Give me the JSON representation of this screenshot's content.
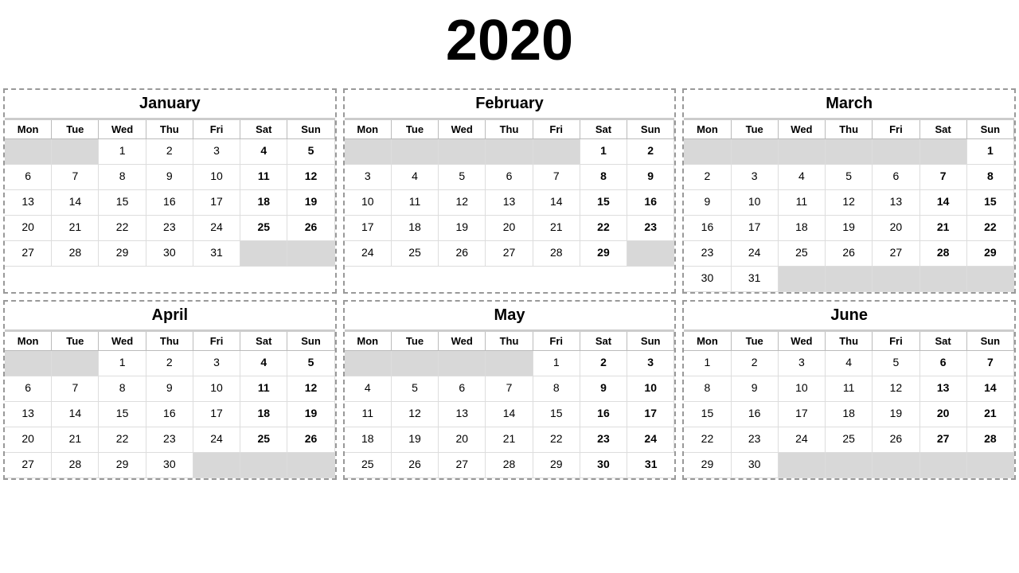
{
  "title": "2020",
  "months": [
    {
      "name": "January",
      "startDay": 2,
      "days": 31,
      "weeks": [
        [
          null,
          null,
          1,
          2,
          3,
          4,
          5
        ],
        [
          6,
          7,
          8,
          9,
          10,
          11,
          12
        ],
        [
          13,
          14,
          15,
          16,
          17,
          18,
          19
        ],
        [
          20,
          21,
          22,
          23,
          24,
          25,
          26
        ],
        [
          27,
          28,
          29,
          30,
          31,
          null,
          null
        ]
      ]
    },
    {
      "name": "February",
      "startDay": 6,
      "days": 29,
      "weeks": [
        [
          null,
          null,
          null,
          null,
          null,
          1,
          2
        ],
        [
          3,
          4,
          5,
          6,
          7,
          8,
          9
        ],
        [
          10,
          11,
          12,
          13,
          14,
          15,
          16
        ],
        [
          17,
          18,
          19,
          20,
          21,
          22,
          23
        ],
        [
          24,
          25,
          26,
          27,
          28,
          29,
          null
        ]
      ]
    },
    {
      "name": "March",
      "startDay": 0,
      "days": 31,
      "weeks": [
        [
          null,
          null,
          null,
          null,
          null,
          null,
          1
        ],
        [
          2,
          3,
          4,
          5,
          6,
          7,
          8
        ],
        [
          9,
          10,
          11,
          12,
          13,
          14,
          15
        ],
        [
          16,
          17,
          18,
          19,
          20,
          21,
          22
        ],
        [
          23,
          24,
          25,
          26,
          27,
          28,
          29
        ],
        [
          30,
          31,
          null,
          null,
          null,
          null,
          null
        ]
      ]
    },
    {
      "name": "April",
      "startDay": 2,
      "days": 30,
      "weeks": [
        [
          null,
          null,
          1,
          2,
          3,
          4,
          5
        ],
        [
          6,
          7,
          8,
          9,
          10,
          11,
          12
        ],
        [
          13,
          14,
          15,
          16,
          17,
          18,
          19
        ],
        [
          20,
          21,
          22,
          23,
          24,
          25,
          26
        ],
        [
          27,
          28,
          29,
          30,
          null,
          null,
          null
        ]
      ]
    },
    {
      "name": "May",
      "startDay": 4,
      "days": 31,
      "weeks": [
        [
          null,
          null,
          null,
          null,
          1,
          2,
          3
        ],
        [
          4,
          5,
          6,
          7,
          8,
          9,
          10
        ],
        [
          11,
          12,
          13,
          14,
          15,
          16,
          17
        ],
        [
          18,
          19,
          20,
          21,
          22,
          23,
          24
        ],
        [
          25,
          26,
          27,
          28,
          29,
          30,
          31
        ]
      ]
    },
    {
      "name": "June",
      "startDay": 0,
      "days": 30,
      "weeks": [
        [
          1,
          2,
          3,
          4,
          5,
          6,
          7
        ],
        [
          8,
          9,
          10,
          11,
          12,
          13,
          14
        ],
        [
          15,
          16,
          17,
          18,
          19,
          20,
          21
        ],
        [
          22,
          23,
          24,
          25,
          26,
          27,
          28
        ],
        [
          29,
          30,
          null,
          null,
          null,
          null,
          null
        ]
      ]
    }
  ],
  "dayHeaders": [
    "Mon",
    "Tue",
    "Wed",
    "Thu",
    "Fri",
    "Sat",
    "Sun"
  ]
}
